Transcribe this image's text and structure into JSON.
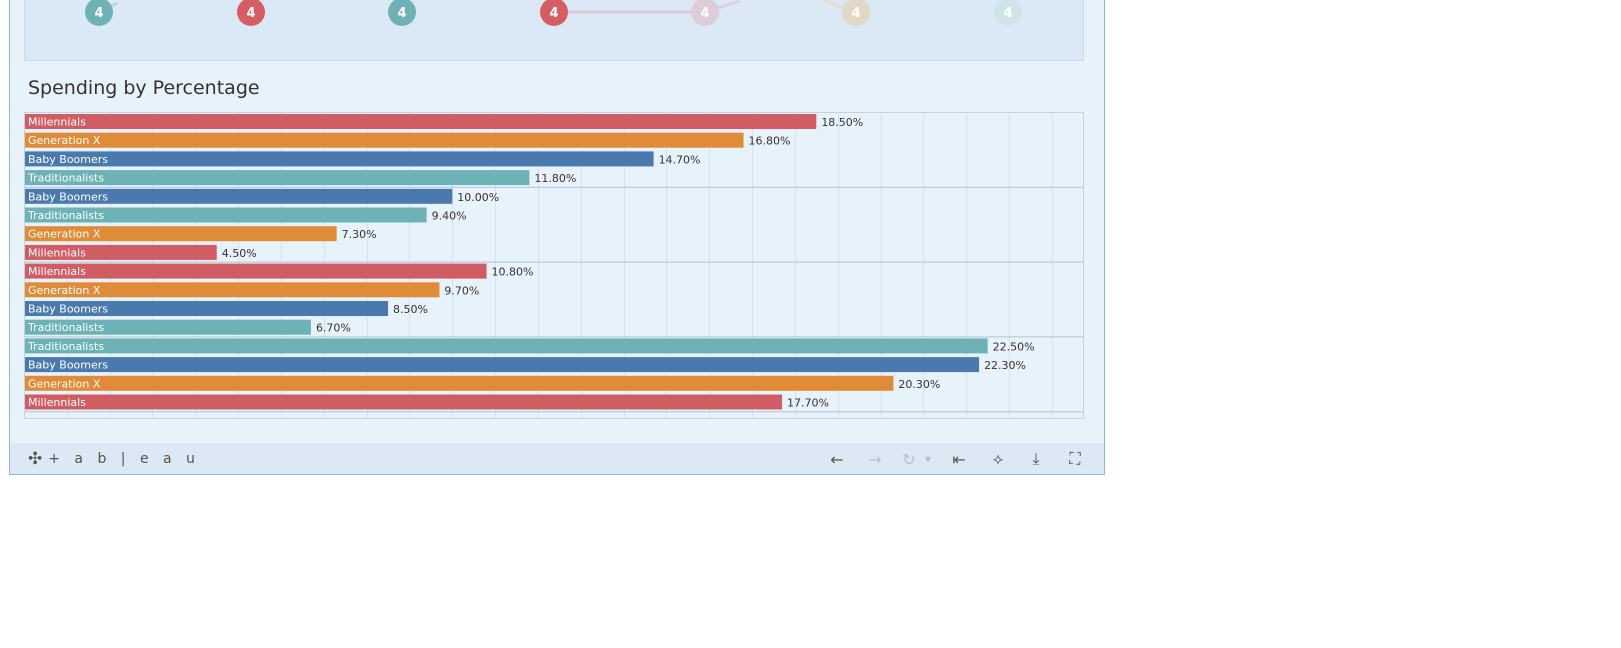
{
  "top_panel": {
    "circle_labels": [
      "4",
      "4",
      "4",
      "4",
      "4",
      "4",
      "4"
    ],
    "colors": [
      "#6fb2b6",
      "#d45e63",
      "#6fb2b6",
      "#d45e63",
      "#dccdd8",
      "#e3d8c6",
      "#cfe4ea"
    ]
  },
  "chart_data": {
    "type": "bar",
    "title": "Spending by Percentage",
    "xlim": [
      0,
      24.75
    ],
    "grid": true,
    "value_format": "percent, 2 decimals",
    "groups": [
      {
        "bars": [
          {
            "category": "Millennials",
            "value": 18.5
          },
          {
            "category": "Generation X",
            "value": 16.8
          },
          {
            "category": "Baby Boomers",
            "value": 14.7
          },
          {
            "category": "Traditionalists",
            "value": 11.8
          }
        ]
      },
      {
        "bars": [
          {
            "category": "Baby Boomers",
            "value": 10.0
          },
          {
            "category": "Traditionalists",
            "value": 9.4
          },
          {
            "category": "Generation X",
            "value": 7.3
          },
          {
            "category": "Millennials",
            "value": 4.5
          }
        ]
      },
      {
        "bars": [
          {
            "category": "Millennials",
            "value": 10.8
          },
          {
            "category": "Generation X",
            "value": 9.7
          },
          {
            "category": "Baby Boomers",
            "value": 8.5
          },
          {
            "category": "Traditionalists",
            "value": 6.7
          }
        ]
      },
      {
        "bars": [
          {
            "category": "Traditionalists",
            "value": 22.5
          },
          {
            "category": "Baby Boomers",
            "value": 22.3
          },
          {
            "category": "Generation X",
            "value": 20.3
          },
          {
            "category": "Millennials",
            "value": 17.7
          }
        ]
      }
    ],
    "colors": {
      "Millennials": "#d05c64",
      "Generation X": "#e08b38",
      "Baby Boomers": "#4a79ae",
      "Traditionalists": "#6db2b4"
    }
  },
  "toolbar": {
    "logo_text": "+ a b | e a u",
    "undo_icon": "←",
    "redo_icon": "→",
    "revert_icon": "↻",
    "dropdown_icon": "▾",
    "reset_icon": "⇤",
    "share_icon": "⟡",
    "download_icon": "⤓",
    "fullscreen_icon": "⛶"
  }
}
